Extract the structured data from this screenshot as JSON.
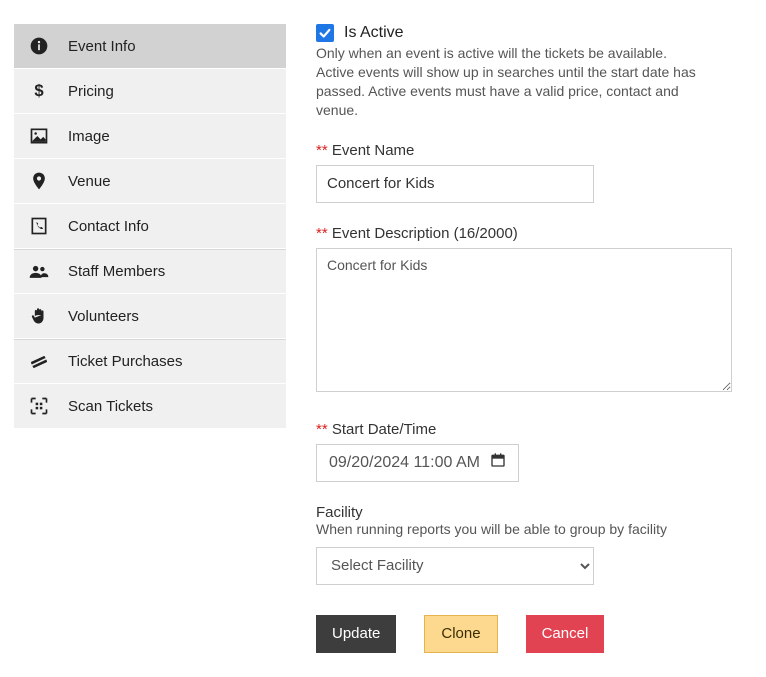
{
  "sidebar": {
    "items": [
      {
        "label": "Event Info"
      },
      {
        "label": "Pricing"
      },
      {
        "label": "Image"
      },
      {
        "label": "Venue"
      },
      {
        "label": "Contact Info"
      },
      {
        "label": "Staff Members"
      },
      {
        "label": "Volunteers"
      },
      {
        "label": "Ticket Purchases"
      },
      {
        "label": "Scan Tickets"
      }
    ]
  },
  "form": {
    "is_active_label": "Is Active",
    "is_active_help": "Only when an event is active will the tickets be available. Active events will show up in searches until the start date has passed. Active events must have a valid price, contact and venue.",
    "required_marker": "**",
    "event_name_label": "Event Name",
    "event_name_value": "Concert for Kids",
    "event_desc_label": "Event Description (16/2000)",
    "event_desc_value": "Concert for Kids",
    "start_date_label": "Start Date/Time",
    "start_date_value": "09/20/2024 11:00 AM",
    "facility_label": "Facility",
    "facility_help": "When running reports you will be able to group by facility",
    "facility_selected": "Select Facility"
  },
  "buttons": {
    "update": "Update",
    "clone": "Clone",
    "cancel": "Cancel"
  }
}
